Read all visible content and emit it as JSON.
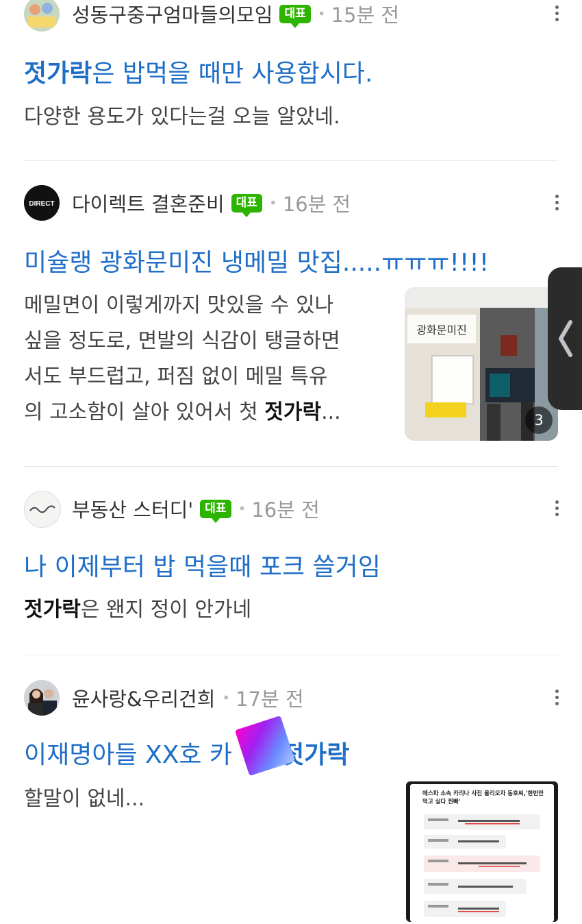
{
  "posts": [
    {
      "cafe": "성동구중구엄마들의모임",
      "badge": "대표",
      "time": "15분 전",
      "title_bold": "젓가락",
      "title_rest": "은 밥먹을 때만 사용합시다.",
      "snippet": "다양한 용도가 있다는걸 오늘 알았네."
    },
    {
      "cafe": "다이렉트 결혼준비",
      "badge": "대표",
      "time": "16분 전",
      "avatar_text": "DIRECT",
      "title": "미슐랭 광화문미진 냉메밀 맛집.....ㅠㅠㅠ!!!!",
      "snippet_lines": [
        "메밀면이 이렇게까지 맛있을 수 있나",
        "싶을 정도로, 면발의 식감이 탱글하면",
        "서도 부드럽고, 퍼짐 없이 메밀 특유",
        "의 고소함이 살아 있어서 첫 "
      ],
      "snippet_bold": "젓가락",
      "snippet_end": "...",
      "thumb_count": "3",
      "thumb_sign": "광화문미진"
    },
    {
      "cafe": "부동산 스터디'",
      "badge": "대표",
      "time": "16분 전",
      "title": "나 이제부터 밥 먹을때 포크 쓸거임",
      "snippet_bold": "젓가락",
      "snippet_rest": "은 왠지 정이 안가네"
    },
    {
      "cafe": "윤사랑&우리건희",
      "time": "17분 전",
      "title_start": "이재명아들 XX호 카",
      "title_bold": "젓가락",
      "snippet": "할말이 없네...",
      "thumb_heading": "에스파 소속 카리나 사진 올리오자 동호씨,'한번만 먹고 싶다 찐빠'"
    }
  ],
  "colors": {
    "title": "#1e6ec8",
    "badge": "#2db400"
  },
  "icons": {
    "more": "more-vertical-icon",
    "handle": "chevron-left-icon"
  }
}
